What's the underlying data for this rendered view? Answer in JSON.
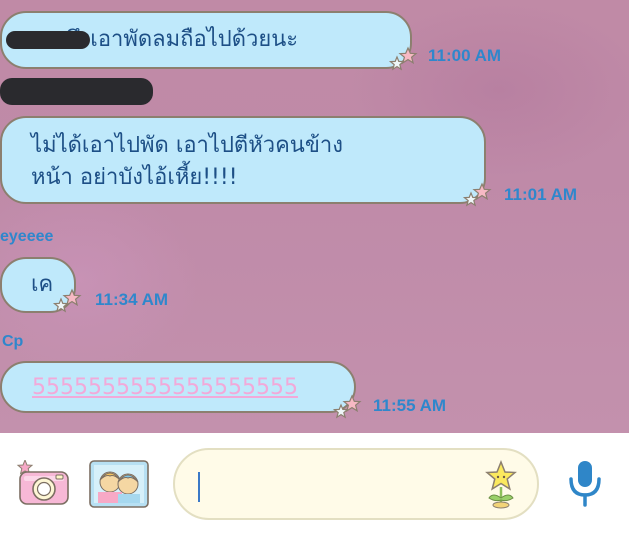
{
  "messages": [
    {
      "text": "บางมึงเอาพัดลมถือไปด้วยนะ",
      "time": "11:00 AM"
    },
    {
      "text_line1": "ไม่ได้เอาไปพัด เอาไปตีหัวคนข้าง",
      "text_line2": "หน้า อย่าบังไอ้เหี้ย!!!!",
      "time": "11:01 AM"
    },
    {
      "sender": "eyeeee",
      "text": "เค",
      "time": "11:34 AM"
    },
    {
      "sender": "Cp",
      "text": "5555555555555555555",
      "time": "11:55 AM"
    }
  ],
  "composer": {
    "value": "",
    "placeholder": ""
  },
  "icons": {
    "camera": "camera-icon",
    "photo": "photo-icon",
    "sticker": "sticker-star-icon",
    "mic": "microphone-icon"
  },
  "colors": {
    "bubble": "#bfe9fb",
    "bubble_border": "#8c7f6f",
    "time": "#2f87cc",
    "mic": "#2f86c8",
    "link": "#f2a9d9"
  }
}
